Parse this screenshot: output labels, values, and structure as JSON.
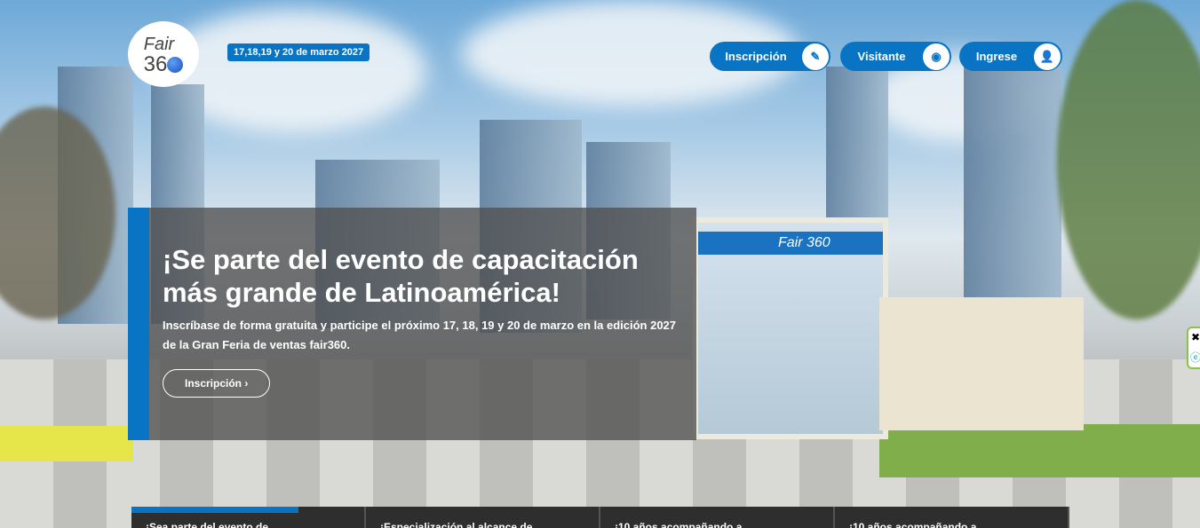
{
  "header": {
    "logo_text": "Fair 360",
    "date_badge": "17,18,19 y 20 de marzo 2027",
    "nav": [
      {
        "label": "Inscripción",
        "icon": "pencil-icon"
      },
      {
        "label": "Visitante",
        "icon": "eye-icon"
      },
      {
        "label": "Ingrese",
        "icon": "user-icon"
      }
    ]
  },
  "hero": {
    "title": "¡Se parte del evento de capacitación más grande de Latinoamérica!",
    "text": "Inscríbase de forma gratuita y participe el próximo 17, 18, 19 y 20 de marzo en la edición 2027 de la Gran Feria de ventas fair360.",
    "cta": "Inscripción ›"
  },
  "pavilion_sign": "Fair 360",
  "tabs": [
    "¡Sea parte del evento de",
    "¡Especialización al alcance de",
    "¡10 años acompañando a",
    "¡10 años acompañando a"
  ],
  "colors": {
    "brand": "#0a74c4"
  }
}
